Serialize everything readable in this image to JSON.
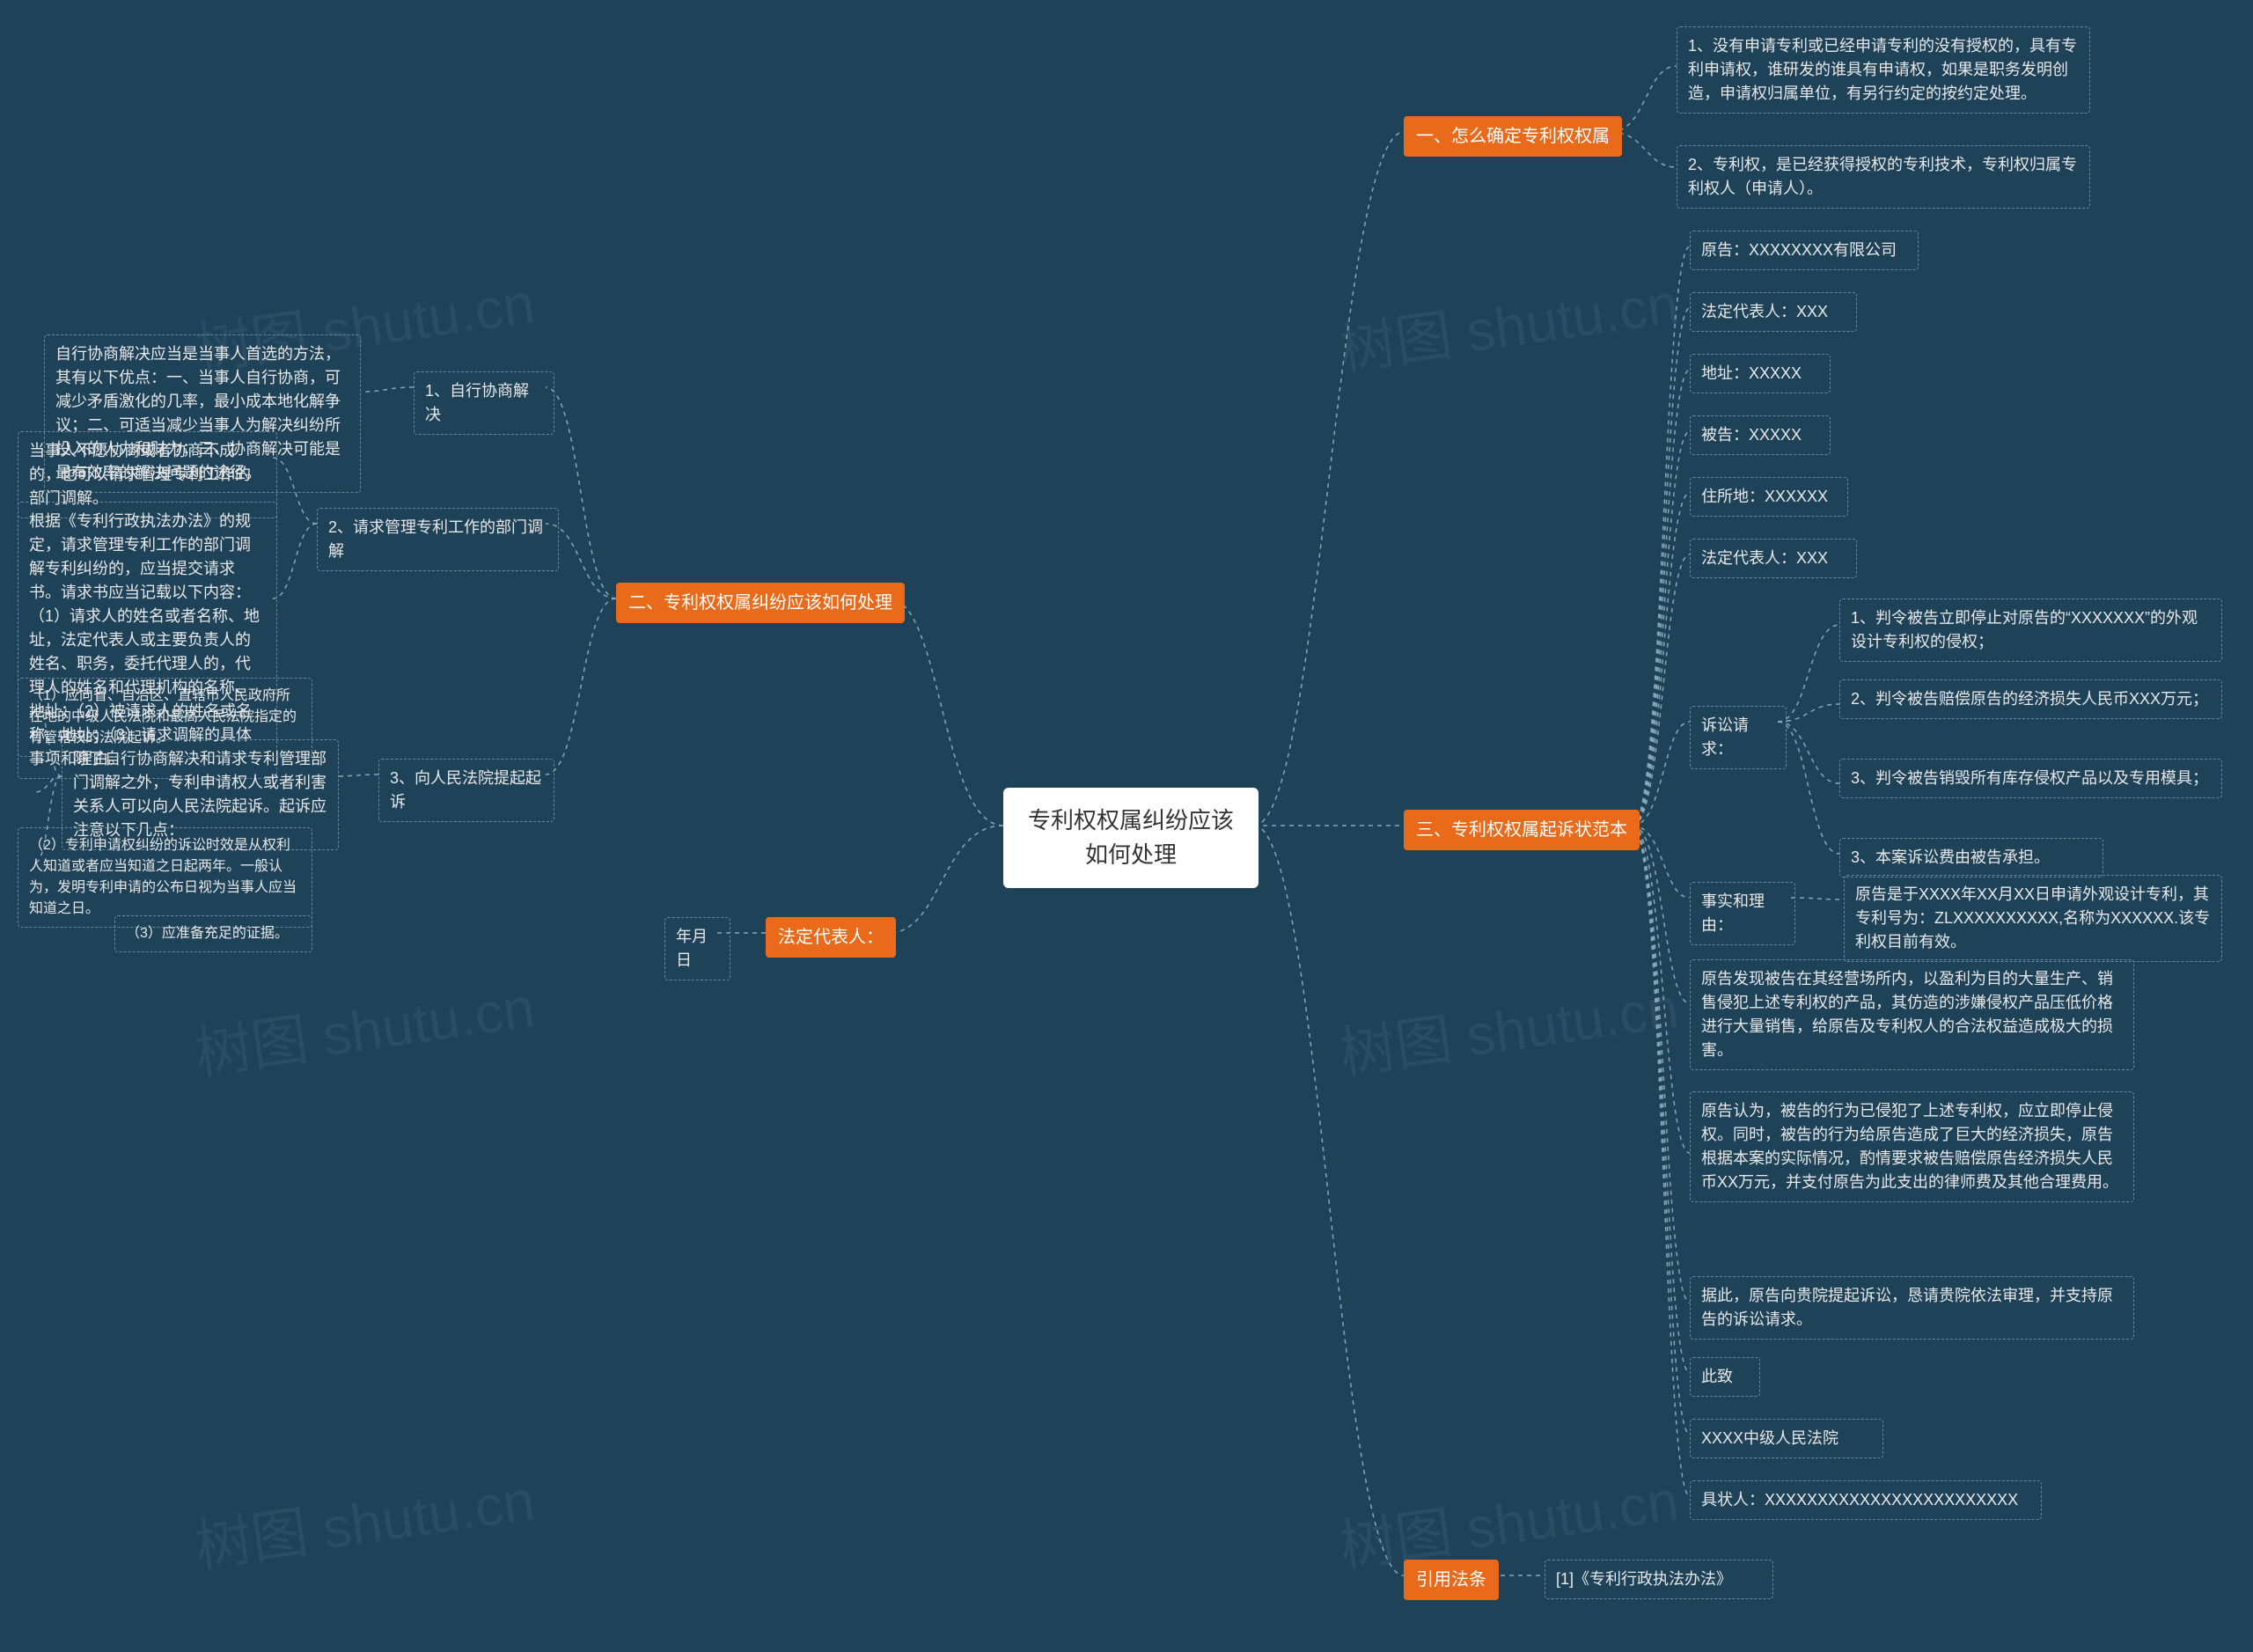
{
  "root": "专利权权属纠纷应该如何处理",
  "watermark": "树图 shutu.cn",
  "branches": {
    "b1": "一、怎么确定专利权权属",
    "b2": "二、专利权权属纠纷应该如何处理",
    "b3": "三、专利权权属起诉状范本",
    "b4": "引用法条",
    "b5": "法定代表人："
  },
  "b1_children": {
    "c1": "1、没有申请专利或已经申请专利的没有授权的，具有专利申请权，谁研发的谁具有申请权，如果是职务发明创造，申请权归属单位，有另行约定的按约定处理。",
    "c2": "2、专利权，是已经获得授权的专利技术，专利权归属专利权人（申请人）。"
  },
  "b2_children": {
    "c1": "1、自行协商解决",
    "c2": "2、请求管理专利工作的部门调解",
    "c3": "3、向人民法院提起起诉"
  },
  "b2_c1_children": {
    "d1": "自行协商解决应当是当事人首选的方法，其有以下优点：一、当事人自行协商，可减少矛盾激化的几率，最小成本地化解争议；二、可适当减少当事人为解决纠纷所投入的人力和财力；三、协商解决可能是最有效率的解决问题的途径。"
  },
  "b2_c2_children": {
    "d1": "当事人不愿协商或者协商不成的，也可以请求管理专利工作的部门调解。",
    "d2": "根据《专利行政执法办法》的规定，请求管理专利工作的部门调解专利纠纷的，应当提交请求书。请求书应当记载以下内容：（1）请求人的姓名或者名称、地址，法定代表人或主要负责人的姓名、职务，委托代理人的，代理人的姓名和代理机构的名称、地址；（2）被请求人的姓名或名称、地址；（3）请求调解的具体事项和理由。"
  },
  "b2_c3_children": {
    "d1": "除了自行协商解决和请求专利管理部门调解之外，专利申请权人或者利害关系人可以向人民法院起诉。起诉应注意以下几点：",
    "e1": "（1）应向省、自治区、直辖市人民政府所在地的中级人民法院和最高人民法院指定的有管辖权的法院起诉。",
    "e2": "（2）专利申请权纠纷的诉讼时效是从权利人知道或者应当知道之日起两年。一般认为，发明专利申请的公布日视为当事人应当知道之日。",
    "e3": "（3）应准备充足的证据。"
  },
  "b3_children": {
    "c1": "原告：XXXXXXXX有限公司",
    "c2": "法定代表人：XXX",
    "c3": "地址：XXXXX",
    "c4": "被告：XXXXX",
    "c5": "住所地：XXXXXX",
    "c6": "法定代表人：XXX",
    "c7": "诉讼请求：",
    "c8": "事实和理由：",
    "c9": "原告发现被告在其经营场所内，以盈利为目的大量生产、销售侵犯上述专利权的产品，其仿造的涉嫌侵权产品压低价格进行大量销售，给原告及专利权人的合法权益造成极大的损害。",
    "c10": "原告认为，被告的行为已侵犯了上述专利权，应立即停止侵权。同时，被告的行为给原告造成了巨大的经济损失，原告根据本案的实际情况，酌情要求被告赔偿原告经济损失人民币XX万元，并支付原告为此支出的律师费及其他合理费用。",
    "c11": "据此，原告向贵院提起诉讼，恳请贵院依法审理，并支持原告的诉讼请求。",
    "c12": "此致",
    "c13": "XXXX中级人民法院",
    "c14": "具状人：XXXXXXXXXXXXXXXXXXXXXXXX"
  },
  "b3_c7_children": {
    "d1": "1、判令被告立即停止对原告的“XXXXXXX”的外观设计专利权的侵权；",
    "d2": "2、判令被告赔偿原告的经济损失人民币XXX万元；",
    "d3": "3、判令被告销毁所有库存侵权产品以及专用模具；",
    "d4": "3、本案诉讼费由被告承担。"
  },
  "b3_c8_children": {
    "d1": "原告是于XXXX年XX月XX日申请外观设计专利，其专利号为：ZLXXXXXXXXXX,名称为XXXXXX.该专利权目前有效。"
  },
  "b4_children": {
    "c1": "[1]《专利行政执法办法》"
  },
  "b5_children": {
    "c1": "年月日"
  },
  "chart_data": {
    "type": "mindmap",
    "root": "专利权权属纠纷应该如何处理",
    "children": [
      {
        "label": "一、怎么确定专利权权属",
        "side": "right",
        "children": [
          {
            "label": "1、没有申请专利或已经申请专利的没有授权的，具有专利申请权，谁研发的谁具有申请权，如果是职务发明创造，申请权归属单位，有另行约定的按约定处理。"
          },
          {
            "label": "2、专利权，是已经获得授权的专利技术，专利权归属专利权人（申请人）。"
          }
        ]
      },
      {
        "label": "二、专利权权属纠纷应该如何处理",
        "side": "left",
        "children": [
          {
            "label": "1、自行协商解决",
            "children": [
              {
                "label": "自行协商解决应当是当事人首选的方法，其有以下优点：一、当事人自行协商，可减少矛盾激化的几率，最小成本地化解争议；二、可适当减少当事人为解决纠纷所投入的人力和财力；三、协商解决可能是最有效率的解决问题的途径。"
              }
            ]
          },
          {
            "label": "2、请求管理专利工作的部门调解",
            "children": [
              {
                "label": "当事人不愿协商或者协商不成的，也可以请求管理专利工作的部门调解。"
              },
              {
                "label": "根据《专利行政执法办法》的规定，请求管理专利工作的部门调解专利纠纷的，应当提交请求书。请求书应当记载以下内容：（1）请求人的姓名或者名称、地址，法定代表人或主要负责人的姓名、职务，委托代理人的，代理人的姓名和代理机构的名称、地址；（2）被请求人的姓名或名称、地址；（3）请求调解的具体事项和理由。"
              }
            ]
          },
          {
            "label": "3、向人民法院提起起诉",
            "children": [
              {
                "label": "除了自行协商解决和请求专利管理部门调解之外，专利申请权人或者利害关系人可以向人民法院起诉。起诉应注意以下几点：",
                "children": [
                  {
                    "label": "（1）应向省、自治区、直辖市人民政府所在地的中级人民法院和最高人民法院指定的有管辖权的法院起诉。"
                  },
                  {
                    "label": "（2）专利申请权纠纷的诉讼时效是从权利人知道或者应当知道之日起两年。一般认为，发明专利申请的公布日视为当事人应当知道之日。"
                  },
                  {
                    "label": "（3）应准备充足的证据。"
                  }
                ]
              }
            ]
          }
        ]
      },
      {
        "label": "三、专利权权属起诉状范本",
        "side": "right",
        "children": [
          {
            "label": "原告：XXXXXXXX有限公司"
          },
          {
            "label": "法定代表人：XXX"
          },
          {
            "label": "地址：XXXXX"
          },
          {
            "label": "被告：XXXXX"
          },
          {
            "label": "住所地：XXXXXX"
          },
          {
            "label": "法定代表人：XXX"
          },
          {
            "label": "诉讼请求：",
            "children": [
              {
                "label": "1、判令被告立即停止对原告的“XXXXXXX”的外观设计专利权的侵权；"
              },
              {
                "label": "2、判令被告赔偿原告的经济损失人民币XXX万元；"
              },
              {
                "label": "3、判令被告销毁所有库存侵权产品以及专用模具；"
              },
              {
                "label": "3、本案诉讼费由被告承担。"
              }
            ]
          },
          {
            "label": "事实和理由：",
            "children": [
              {
                "label": "原告是于XXXX年XX月XX日申请外观设计专利，其专利号为：ZLXXXXXXXXXX,名称为XXXXXX.该专利权目前有效。"
              }
            ]
          },
          {
            "label": "原告发现被告在其经营场所内，以盈利为目的大量生产、销售侵犯上述专利权的产品，其仿造的涉嫌侵权产品压低价格进行大量销售，给原告及专利权人的合法权益造成极大的损害。"
          },
          {
            "label": "原告认为，被告的行为已侵犯了上述专利权，应立即停止侵权。同时，被告的行为给原告造成了巨大的经济损失，原告根据本案的实际情况，酌情要求被告赔偿原告经济损失人民币XX万元，并支付原告为此支出的律师费及其他合理费用。"
          },
          {
            "label": "据此，原告向贵院提起诉讼，恳请贵院依法审理，并支持原告的诉讼请求。"
          },
          {
            "label": "此致"
          },
          {
            "label": "XXXX中级人民法院"
          },
          {
            "label": "具状人：XXXXXXXXXXXXXXXXXXXXXXXX"
          }
        ]
      },
      {
        "label": "引用法条",
        "side": "right",
        "children": [
          {
            "label": "[1]《专利行政执法办法》"
          }
        ]
      },
      {
        "label": "法定代表人：",
        "side": "left",
        "children": [
          {
            "label": "年月日"
          }
        ]
      }
    ]
  }
}
